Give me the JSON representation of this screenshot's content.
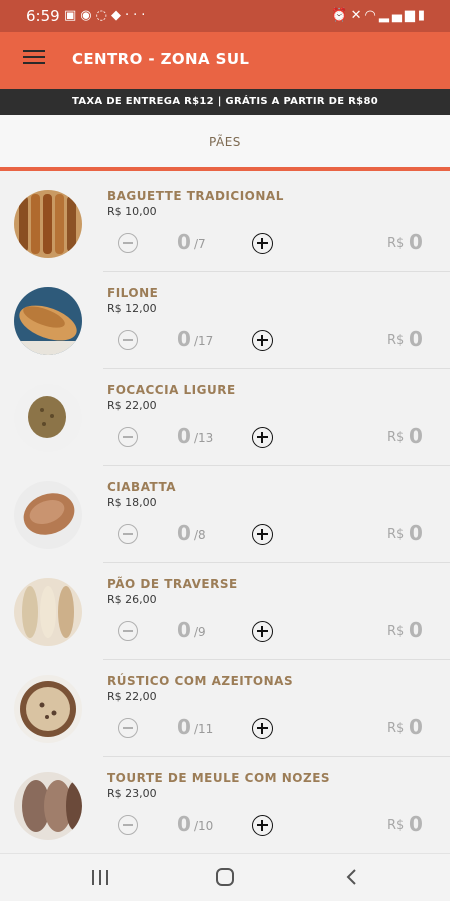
{
  "status_bar": {
    "time": "6:59",
    "left_icons": [
      "notification-icon",
      "maps-icon",
      "whatsapp-icon",
      "vpn-icon",
      "more-dots-icon"
    ],
    "right_icons": [
      "alarm-icon",
      "mute-icon",
      "wifi-icon",
      "signal-icon",
      "battery-icon"
    ]
  },
  "header": {
    "title": "CENTRO - ZONA SUL"
  },
  "banner": {
    "text": "TAXA DE ENTREGA R$12 | GRÁTIS A PARTIR DE R$80"
  },
  "category": {
    "title": "PÃES"
  },
  "products": [
    {
      "name": "BAGUETTE TRADICIONAL",
      "price": "R$ 10,00",
      "qty": "0",
      "max": "/7",
      "currency": "R$",
      "total": "0",
      "image": "baguette-photo"
    },
    {
      "name": "FILONE",
      "price": "R$ 12,00",
      "qty": "0",
      "max": "/17",
      "currency": "R$",
      "total": "0",
      "image": "filone-photo"
    },
    {
      "name": "FOCACCIA LIGURE",
      "price": "R$ 22,00",
      "qty": "0",
      "max": "/13",
      "currency": "R$",
      "total": "0",
      "image": "focaccia-photo"
    },
    {
      "name": "CIABATTA",
      "price": "R$ 18,00",
      "qty": "0",
      "max": "/8",
      "currency": "R$",
      "total": "0",
      "image": "ciabatta-photo"
    },
    {
      "name": "PÃO DE TRAVERSE",
      "price": "R$ 26,00",
      "qty": "0",
      "max": "/9",
      "currency": "R$",
      "total": "0",
      "image": "traverse-photo"
    },
    {
      "name": "RÚSTICO COM AZEITONAS",
      "price": "R$ 22,00",
      "qty": "0",
      "max": "/11",
      "currency": "R$",
      "total": "0",
      "image": "rustico-photo"
    },
    {
      "name": "TOURTE DE MEULE COM NOZES",
      "price": "R$ 23,00",
      "qty": "0",
      "max": "/10",
      "currency": "R$",
      "total": "0",
      "image": "tourte-photo"
    }
  ],
  "colors": {
    "status_bar": "#c2503a",
    "app_bar": "#e96444",
    "banner": "#2f2f2f",
    "product_name": "#9c7d57",
    "accent_underline": "#e96444"
  },
  "nav_bar": {
    "buttons": [
      "recents-icon",
      "home-icon",
      "back-icon"
    ]
  }
}
